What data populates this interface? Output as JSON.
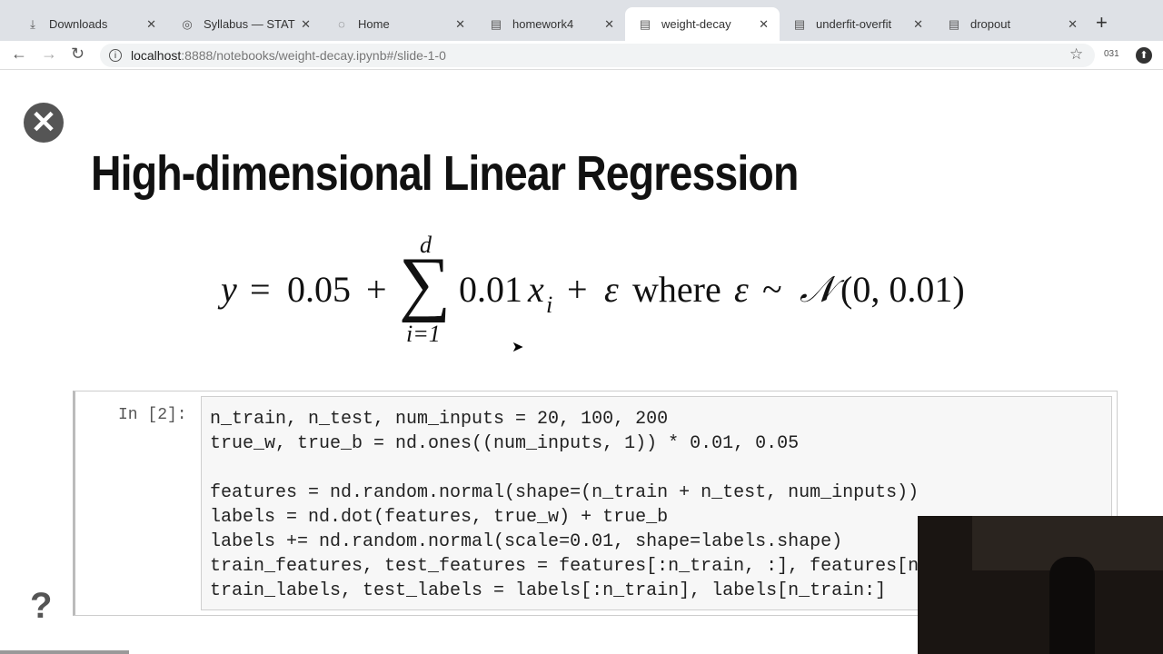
{
  "browser": {
    "tabs": [
      {
        "label": "Downloads",
        "icon": "download-icon"
      },
      {
        "label": "Syllabus — STAT",
        "icon": "globe-icon"
      },
      {
        "label": "Home",
        "icon": "loading-icon"
      },
      {
        "label": "homework4",
        "icon": "jupyter-icon"
      },
      {
        "label": "weight-decay",
        "icon": "jupyter-icon",
        "active": true
      },
      {
        "label": "underfit-overfit",
        "icon": "jupyter-icon"
      },
      {
        "label": "dropout",
        "icon": "jupyter-icon"
      }
    ],
    "url_host": "localhost",
    "url_path": ":8888/notebooks/weight-decay.ipynb#/slide-1-0",
    "extension_badge": "031"
  },
  "slide": {
    "title": "High-dimensional Linear Regression",
    "formula": {
      "y": "y",
      "eq": "=",
      "b": "0.05",
      "plus1": "+",
      "sum": "∑",
      "upper": "d",
      "lower": "i=1",
      "coef": "0.01",
      "x": "x",
      "sub": "i",
      "plus2": "+",
      "eps": "ε",
      "where": "where",
      "eps2": "ε",
      "sim": "~",
      "N": "𝒩",
      "params": "(0, 0.01)"
    },
    "cell": {
      "prompt": "In [2]:",
      "code": [
        "n_train, n_test, num_inputs = 20, 100, 200",
        "true_w, true_b = nd.ones((num_inputs, 1)) * 0.01, 0.05",
        "",
        "features = nd.random.normal(shape=(n_train + n_test, num_inputs))",
        "labels = nd.dot(features, true_w) + true_b",
        "labels += nd.random.normal(scale=0.01, shape=labels.shape)",
        "train_features, test_features = features[:n_train, :], features[n_train:, :]",
        "train_labels, test_labels = labels[:n_train], labels[n_train:]"
      ]
    },
    "help_label": "?"
  }
}
